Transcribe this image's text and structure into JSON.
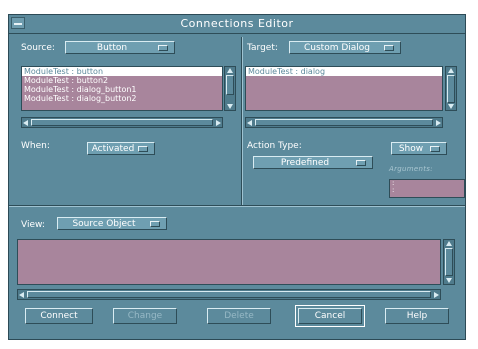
{
  "window": {
    "title": "Connections Editor"
  },
  "source": {
    "label": "Source:",
    "value": "Button",
    "items": [
      "ModuleTest : button",
      "ModuleTest : button2",
      "ModuleTest : dialog_button1",
      "ModuleTest : dialog_button2"
    ]
  },
  "target": {
    "label": "Target:",
    "value": "Custom Dialog",
    "items": [
      "ModuleTest : dialog"
    ]
  },
  "when": {
    "label": "When:",
    "value": "Activated"
  },
  "action": {
    "label": "Action Type:",
    "type_value": "Predefined",
    "show_value": "Show",
    "arguments_label": "Arguments:",
    "args_lines": [
      ":",
      ":"
    ]
  },
  "view": {
    "label": "View:",
    "value": "Source Object"
  },
  "buttons": {
    "connect": "Connect",
    "change": "Change",
    "delete": "Delete",
    "cancel": "Cancel",
    "help": "Help"
  },
  "colors": {
    "background": "#5c8a9c",
    "list": "#a8859c",
    "selection": "#ffffff"
  }
}
